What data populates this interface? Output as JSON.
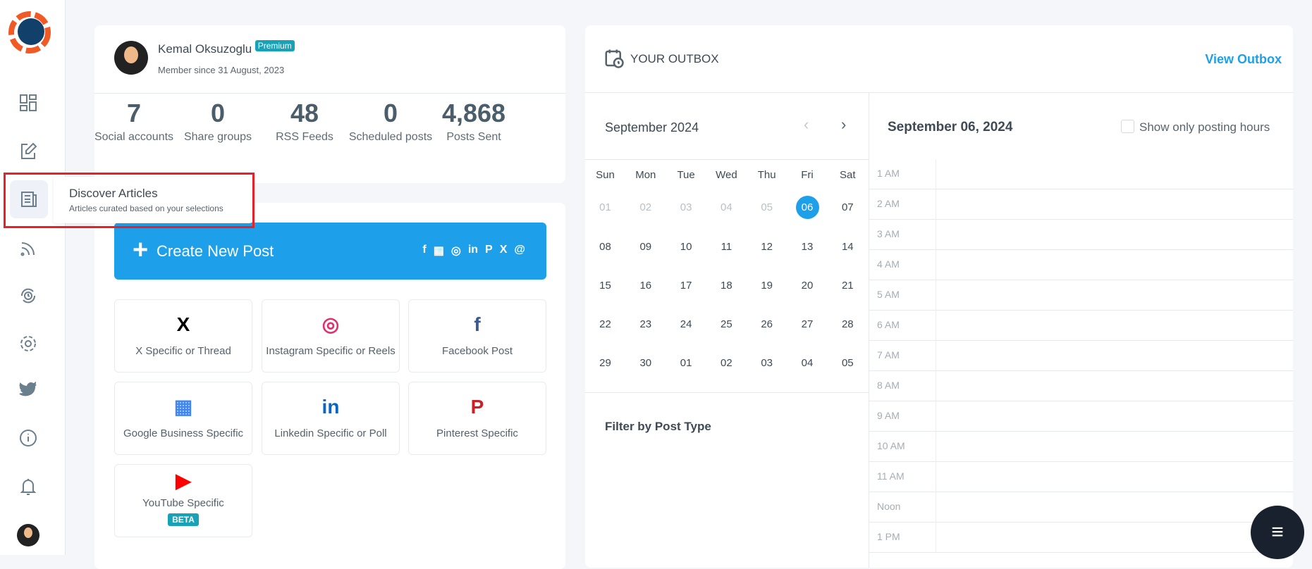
{
  "sidebar": {
    "items": [
      "dashboard-icon",
      "compose-icon",
      "articles-icon",
      "rss-icon",
      "recycle-icon",
      "settings-icon",
      "twitter-icon",
      "info-icon",
      "bell-icon",
      "avatar"
    ]
  },
  "tooltip": {
    "title": "Discover Articles",
    "subtitle": "Articles curated based on your selections"
  },
  "profile": {
    "name": "Kemal Oksuzoglu",
    "badge": "Premium",
    "member_since": "Member since 31 August, 2023"
  },
  "stats": [
    {
      "value": "7",
      "label": "Social accounts"
    },
    {
      "value": "0",
      "label": "Share groups"
    },
    {
      "value": "48",
      "label": "RSS Feeds"
    },
    {
      "value": "0",
      "label": "Scheduled posts"
    },
    {
      "value": "4,868",
      "label": "Posts Sent"
    }
  ],
  "create": {
    "label": "Create New Post",
    "networks": [
      "f",
      "▦",
      "◎",
      "in",
      "P",
      "X",
      "@"
    ]
  },
  "tiles": [
    {
      "icon": "X",
      "label": "X Specific or Thread",
      "color": "#000000"
    },
    {
      "icon": "◎",
      "label": "Instagram Specific or Reels",
      "color": "#e1306c"
    },
    {
      "icon": "f",
      "label": "Facebook Post",
      "color": "#3b5998"
    },
    {
      "icon": "▦",
      "label": "Google Business Specific",
      "color": "#4285f4"
    },
    {
      "icon": "in",
      "label": "Linkedin Specific or Poll",
      "color": "#0a66c2"
    },
    {
      "icon": "P",
      "label": "Pinterest Specific",
      "color": "#cb2027"
    },
    {
      "icon": "▶",
      "label": "YouTube Specific",
      "color": "#ff0000",
      "badge": "BETA"
    }
  ],
  "outbox": {
    "title": "YOUR OUTBOX",
    "link": "View Outbox",
    "month": "September 2024",
    "selected_date": "September 06, 2024",
    "checkbox_label": "Show only posting hours",
    "checked": false,
    "filter_title": "Filter by Post Type",
    "weekdays": [
      "Sun",
      "Mon",
      "Tue",
      "Wed",
      "Thu",
      "Fri",
      "Sat"
    ],
    "days": [
      [
        "01",
        "02",
        "03",
        "04",
        "05",
        "06",
        "07"
      ],
      [
        "08",
        "09",
        "10",
        "11",
        "12",
        "13",
        "14"
      ],
      [
        "15",
        "16",
        "17",
        "18",
        "19",
        "20",
        "21"
      ],
      [
        "22",
        "23",
        "24",
        "25",
        "26",
        "27",
        "28"
      ],
      [
        "29",
        "30",
        "01",
        "02",
        "03",
        "04",
        "05"
      ]
    ],
    "selected_day": "06",
    "hours": [
      "1 AM",
      "2 AM",
      "3 AM",
      "4 AM",
      "5 AM",
      "6 AM",
      "7 AM",
      "8 AM",
      "9 AM",
      "10 AM",
      "11 AM",
      "Noon",
      "1 PM"
    ]
  },
  "colors": {
    "accent": "#1e9fea",
    "badge": "#17a2b8",
    "highlight": "#e8202a"
  }
}
